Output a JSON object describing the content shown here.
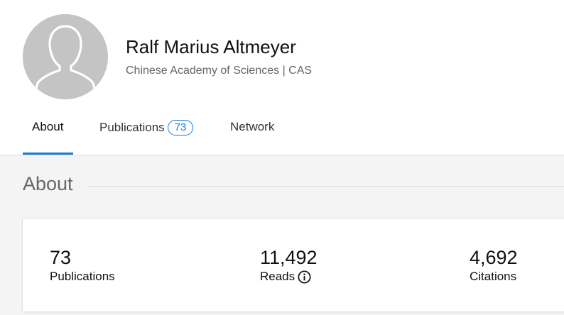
{
  "profile": {
    "name": "Ralf Marius Altmeyer",
    "affiliation": "Chinese Academy of Sciences | CAS",
    "avatar_icon": "default-user-avatar-icon"
  },
  "tabs": [
    {
      "label": "About",
      "active": true
    },
    {
      "label": "Publications",
      "badge": "73",
      "active": false
    },
    {
      "label": "Network",
      "active": false
    }
  ],
  "section": {
    "title": "About"
  },
  "stats": [
    {
      "value": "73",
      "label": "Publications"
    },
    {
      "value": "11,492",
      "label": "Reads",
      "icon": "info-icon"
    },
    {
      "value": "4,692",
      "label": "Citations"
    }
  ],
  "colors": {
    "accent": "#1b7bd8",
    "page_background": "#f4f4f4",
    "avatar_background": "#c4c4c4",
    "secondary_text": "#666666"
  }
}
